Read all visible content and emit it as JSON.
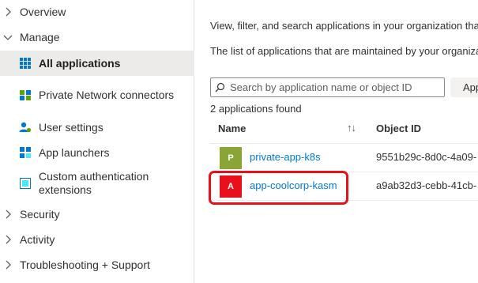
{
  "sidebar": {
    "overview": "Overview",
    "manage": "Manage",
    "items": [
      {
        "label": "All applications",
        "icon": "grid-icon"
      },
      {
        "label": "Private Network connectors",
        "icon": "network-connector-icon"
      },
      {
        "label": "User settings",
        "icon": "user-settings-icon"
      },
      {
        "label": "App launchers",
        "icon": "app-launcher-icon"
      },
      {
        "label": "Custom authentication extensions",
        "icon": "extension-icon"
      }
    ],
    "security": "Security",
    "activity": "Activity",
    "troubleshooting": "Troubleshooting + Support"
  },
  "main": {
    "description1": "View, filter, and search applications in your organization tha",
    "description2": "The list of applications that are maintained by your organiza",
    "search_placeholder": "Search by application name or object ID",
    "filter_pill": "App",
    "found_text": "2 applications found",
    "columns": {
      "name": "Name",
      "object_id": "Object ID"
    },
    "rows": [
      {
        "initial": "P",
        "name": "private-app-k8s",
        "object_id": "9551b29c-8d0c-4a09-",
        "color": "#8aa536"
      },
      {
        "initial": "A",
        "name": "app-coolcorp-kasm",
        "object_id": "a9ab32d3-cebb-41cb-",
        "color": "#e8101a"
      }
    ]
  },
  "colors": {
    "link": "#0078d4",
    "highlight": "#e8101a",
    "active_bg": "#edebe9"
  }
}
